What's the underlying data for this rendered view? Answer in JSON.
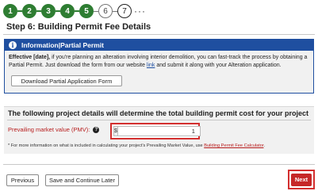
{
  "stepper": {
    "steps": [
      {
        "label": "1",
        "state": "done"
      },
      {
        "label": "2",
        "state": "done"
      },
      {
        "label": "3",
        "state": "done"
      },
      {
        "label": "4",
        "state": "done"
      },
      {
        "label": "5",
        "state": "done"
      },
      {
        "label": "6",
        "state": "current"
      },
      {
        "label": "7",
        "state": "future"
      }
    ],
    "more": "···"
  },
  "page_title": "Step 6: Building Permit Fee Details",
  "info": {
    "heading": "Information|Partial Permit",
    "icon": "info-icon",
    "effective": "Effective [date],",
    "text_1": " if you're planning an alteration involving interior demolition, you can fast-track the process by obtaining a Partial Permit. Just download the form from our website ",
    "link": "link",
    "text_2": " and submit it along with your Alteration application.",
    "download_button": "Download Partial Application Form"
  },
  "cost": {
    "title": "The following project details will determine the total building permit cost for your project",
    "pmv_label": "Prevailing market value (PMV):",
    "help_icon": "question-icon",
    "currency": "$",
    "pmv_value": "1",
    "note_text": "* For more information on what is included in calculating your project's Prevailing Market Value, use ",
    "note_link": "Building Permit Fee Calculator",
    "note_end": "."
  },
  "footer": {
    "previous": "Previous",
    "save_later": "Save and Continue Later",
    "next": "Next"
  },
  "colors": {
    "step_done": "#2e7d32",
    "info_header": "#1f4fa0",
    "highlight_red": "#d32f2f",
    "next_button": "#c62828"
  }
}
